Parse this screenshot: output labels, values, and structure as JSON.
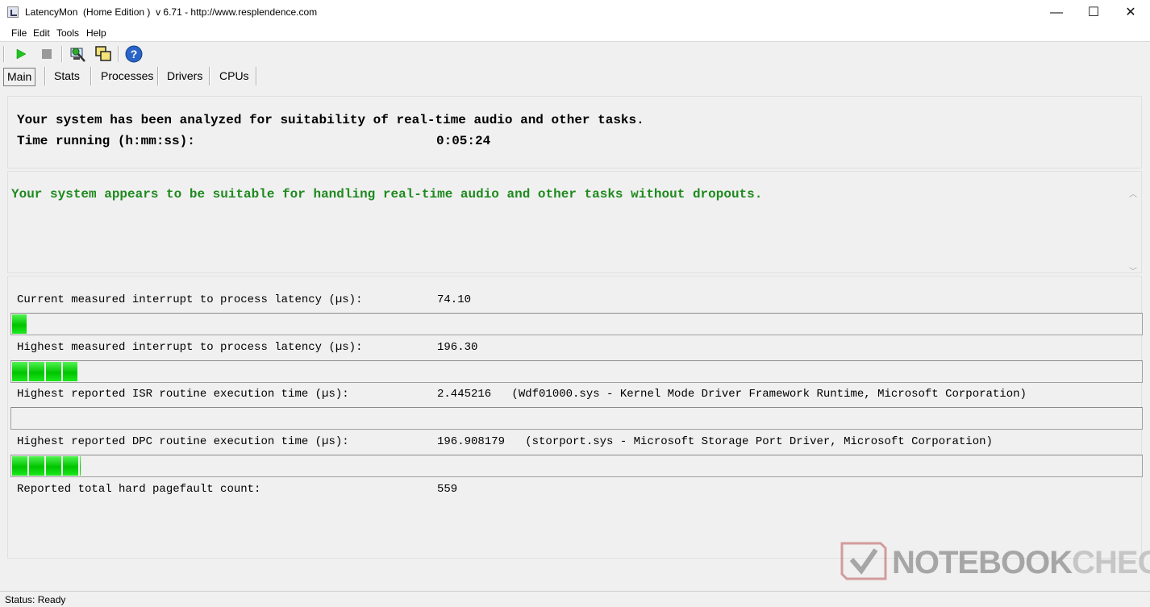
{
  "window": {
    "title": "LatencyMon  (Home Edition )  v 6.71 - http://www.resplendence.com",
    "minimize": "—",
    "maximize": "☐",
    "close": "✕"
  },
  "menu": [
    "File",
    "Edit",
    "Tools",
    "Help"
  ],
  "toolbar": {
    "icons": [
      "play-icon",
      "stop-icon",
      "analyze-icon",
      "windows-icon",
      "help-icon"
    ]
  },
  "tabs": [
    "Main",
    "Stats",
    "Processes",
    "Drivers",
    "CPUs"
  ],
  "main": {
    "analysis_line": "Your system has been analyzed for suitability of real-time audio and other tasks.",
    "time_label": "Time running (h:mm:ss):",
    "time_value": "0:05:24",
    "verdict": "Your system appears to be suitable for handling real-time audio and other tasks without dropouts.",
    "verdict_color": "#1e8a1e",
    "metrics": [
      {
        "label": "Current measured interrupt to process latency (µs):",
        "value": "74.10",
        "bar_fraction": 0.014
      },
      {
        "label": "Highest measured interrupt to process latency (µs):",
        "value": "196.30",
        "bar_fraction": 0.059
      },
      {
        "label": "Highest reported ISR routine execution time (µs):",
        "value": "2.445216   (Wdf01000.sys - Kernel Mode Driver Framework Runtime, Microsoft Corporation)",
        "bar_fraction": 0
      },
      {
        "label": "Highest reported DPC routine execution time (µs):",
        "value": "196.908179   (storport.sys - Microsoft Storage Port Driver, Microsoft Corporation)",
        "bar_fraction": 0.062
      },
      {
        "label": "Reported total hard pagefault count:",
        "value": "559"
      }
    ],
    "bar_color": "#00cc00"
  },
  "status": "Status: Ready",
  "watermark": {
    "note": "NOTEBOOK",
    "check": "CHECK"
  }
}
